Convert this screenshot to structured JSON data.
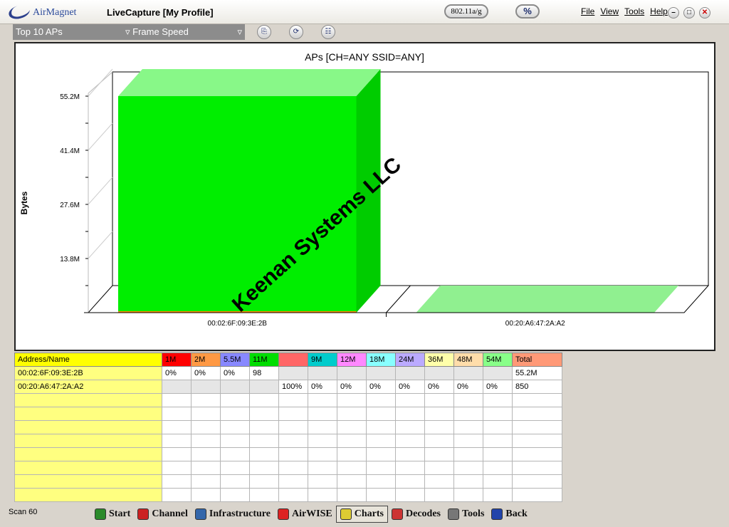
{
  "titlebar": {
    "logo_text": "AirMagnet",
    "app_title": "LiveCapture [My Profile]",
    "band": "802.11a/g",
    "percent": "%",
    "menu": [
      "File",
      "View",
      "Tools",
      "Help"
    ],
    "window_buttons": [
      "–",
      "□",
      "✕"
    ]
  },
  "toolbar": {
    "report": "Top 10 APs",
    "metric": "▿ Frame Speed",
    "dropdown_arrow": "▿",
    "buttons": [
      {
        "name": "export-icon",
        "glyph": "⎘"
      },
      {
        "name": "refresh-icon",
        "glyph": "⟳"
      },
      {
        "name": "legend-icon",
        "glyph": "☷"
      }
    ]
  },
  "colors": {
    "bar_front": "#00ee00",
    "bar_top": "#88f888",
    "bar_side": "#00cc00",
    "ghost": "#90f090"
  },
  "chart_data": {
    "type": "bar",
    "title": "APs [CH=ANY SSID=ANY]",
    "ylabel": "Bytes",
    "xlabel": "",
    "categories": [
      "00:02:6F:09:3E:2B",
      "00:20:A6:47:2A:A2"
    ],
    "values": [
      55.2,
      0.00085
    ],
    "value_unit": "M",
    "ylim": [
      0,
      55.2
    ],
    "y_ticks": [
      {
        "value": 13.8,
        "label": "13.8M"
      },
      {
        "value": 27.6,
        "label": "27.6M"
      },
      {
        "value": 41.4,
        "label": "41.4M"
      },
      {
        "value": 55.2,
        "label": "55.2M"
      }
    ],
    "grid": false,
    "style": "3d"
  },
  "table": {
    "headers": [
      {
        "label": "Address/Name",
        "color": "#ffff00"
      },
      {
        "label": "1M",
        "color": "#ff0000"
      },
      {
        "label": "2M",
        "color": "#ff9944"
      },
      {
        "label": "5.5M",
        "color": "#8888ff"
      },
      {
        "label": "11M",
        "color": "#00dd00"
      },
      {
        "label": "",
        "color": "#ff6666"
      },
      {
        "label": "9M",
        "color": "#00cccc"
      },
      {
        "label": "12M",
        "color": "#ff88ff"
      },
      {
        "label": "18M",
        "color": "#88ffff"
      },
      {
        "label": "24M",
        "color": "#bbaaff"
      },
      {
        "label": "36M",
        "color": "#ffffaa"
      },
      {
        "label": "48M",
        "color": "#ffddaa"
      },
      {
        "label": "54M",
        "color": "#88ff88"
      },
      {
        "label": "Total",
        "color": "#ff9977"
      }
    ],
    "rows": [
      {
        "cells": [
          "00:02:6F:09:3E:2B",
          "0%",
          "0%",
          "0%",
          "98",
          "",
          "",
          "",
          "",
          "",
          "",
          "",
          "",
          "55.2M"
        ],
        "shaded": [
          5,
          6,
          7,
          8,
          9,
          10,
          11,
          12
        ]
      },
      {
        "cells": [
          "00:20:A6:47:2A:A2",
          "",
          "",
          "",
          "",
          "100%",
          "0%",
          "0%",
          "0%",
          "0%",
          "0%",
          "0%",
          "0%",
          "850"
        ],
        "shaded": [
          1,
          2,
          3,
          4
        ]
      }
    ],
    "empty_rows": 8
  },
  "watermark": "Keenan Systems LLC",
  "status": {
    "scan": "Scan 60"
  },
  "nav": [
    {
      "label": "Start",
      "icon": "start-icon",
      "color": "#2a8a2a",
      "active": false
    },
    {
      "label": "Channel",
      "icon": "channel-icon",
      "color": "#cc2222",
      "active": false
    },
    {
      "label": "Infrastructure",
      "icon": "infrastructure-icon",
      "color": "#3366aa",
      "active": false
    },
    {
      "label": "AirWISE",
      "icon": "airwise-icon",
      "color": "#dd2222",
      "active": false
    },
    {
      "label": "Charts",
      "icon": "charts-icon",
      "color": "#ddcc33",
      "active": true
    },
    {
      "label": "Decodes",
      "icon": "decodes-icon",
      "color": "#cc3333",
      "active": false
    },
    {
      "label": "Tools",
      "icon": "tools-icon",
      "color": "#777777",
      "active": false
    },
    {
      "label": "Back",
      "icon": "back-icon",
      "color": "#2244aa",
      "active": false
    }
  ]
}
